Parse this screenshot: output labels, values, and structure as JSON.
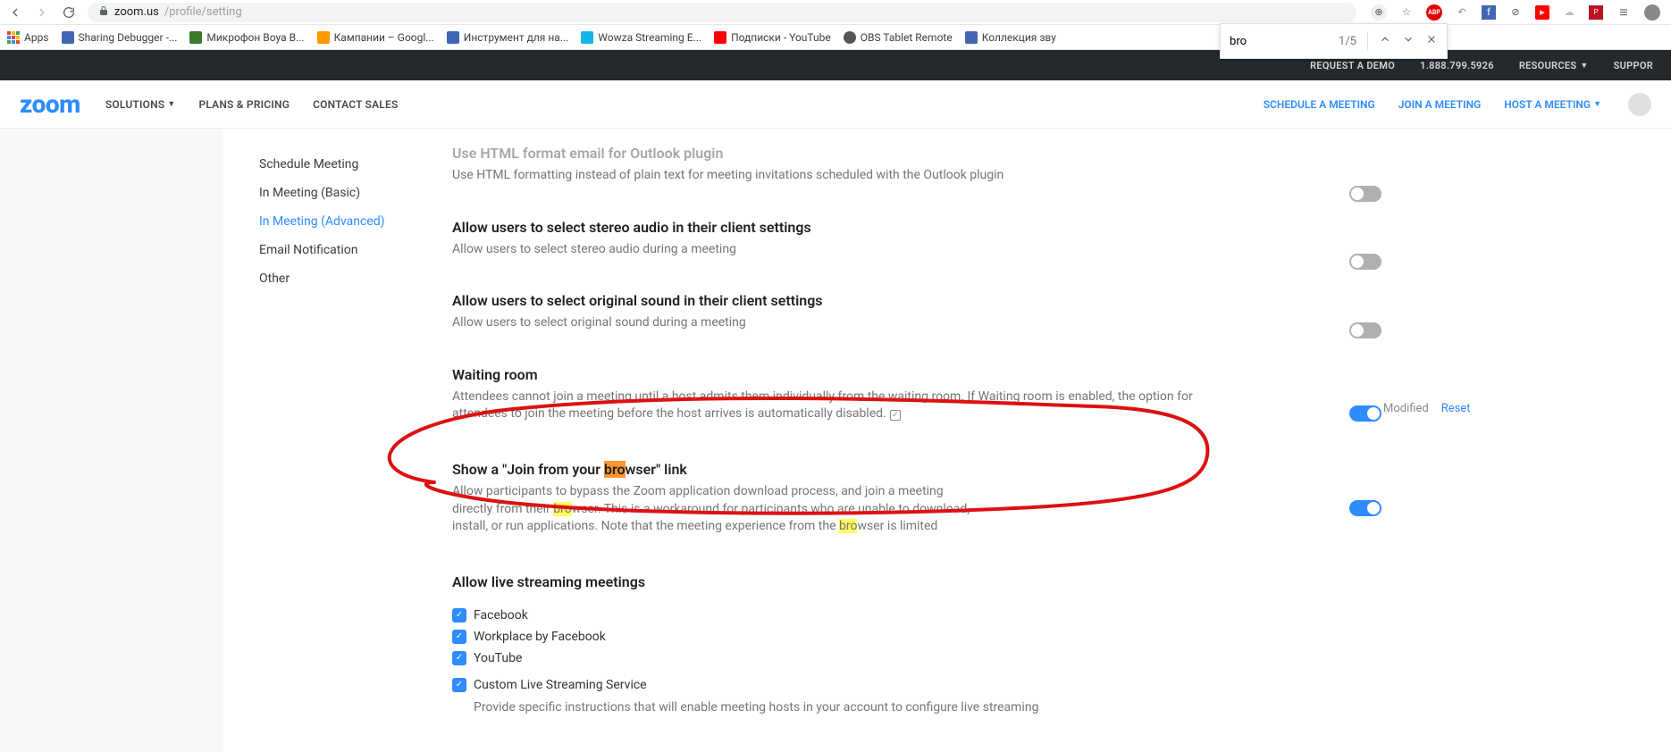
{
  "browser": {
    "url_host": "zoom.us",
    "url_path": "/profile/setting"
  },
  "find": {
    "query": "bro",
    "count": "1/5"
  },
  "bookmarks": [
    {
      "label": "Apps"
    },
    {
      "label": "Sharing Debugger -...",
      "bg": "#4267B2"
    },
    {
      "label": "Микрофон Boya B...",
      "bg": "#3a7a28"
    },
    {
      "label": "Кампании – Googl...",
      "bg": "#ff9800"
    },
    {
      "label": "Инструмент для на...",
      "bg": "#4267B2"
    },
    {
      "label": "Wowza Streaming E...",
      "bg": "#13b5ea"
    },
    {
      "label": "Подписки - YouTube",
      "bg": "#ff0000"
    },
    {
      "label": "OBS Tablet Remote",
      "bg": "#555"
    },
    {
      "label": "Коллекция зву",
      "bg": "#4267B2"
    }
  ],
  "topbar": {
    "demo": "REQUEST A DEMO",
    "phone": "1.888.799.5926",
    "resources": "RESOURCES",
    "support": "SUPPOR"
  },
  "nav": {
    "solutions": "SOLUTIONS",
    "pricing": "PLANS & PRICING",
    "contact": "CONTACT SALES",
    "schedule": "SCHEDULE A MEETING",
    "join": "JOIN A MEETING",
    "host": "HOST A MEETING"
  },
  "sidebar": [
    {
      "label": "Schedule Meeting",
      "active": false
    },
    {
      "label": "In Meeting (Basic)",
      "active": false
    },
    {
      "label": "In Meeting (Advanced)",
      "active": true
    },
    {
      "label": "Email Notification",
      "active": false
    },
    {
      "label": "Other",
      "active": false
    }
  ],
  "settings": {
    "s0": {
      "title": "Use HTML format email for Outlook plugin",
      "desc": "Use HTML formatting instead of plain text for meeting invitations scheduled with the Outlook plugin"
    },
    "s1": {
      "title": "Allow users to select stereo audio in their client settings",
      "desc": "Allow users to select stereo audio during a meeting"
    },
    "s2": {
      "title": "Allow users to select original sound in their client settings",
      "desc": "Allow users to select original sound during a meeting"
    },
    "s3": {
      "title": "Waiting room",
      "desc": "Attendees cannot join a meeting until a host admits them individually from the waiting room. If Waiting room is enabled, the option for attendees to join the meeting before the host arrives is automatically disabled."
    },
    "s4": {
      "title_a": "Show a \"Join from your ",
      "title_b": "bro",
      "title_c": "wser\" link",
      "desc_a": "Allow participants to bypass the Zoom application download process, and join a meeting directly from their ",
      "desc_b": "bro",
      "desc_c": "wser. This is a workaround for participants who are unable to download, install, or run applications. Note that the meeting experience from the ",
      "desc_d": "bro",
      "desc_e": "wser is limited"
    },
    "s5": {
      "title": "Allow live streaming meetings"
    },
    "modified": "Modified",
    "reset": "Reset",
    "stream_opts": [
      "Facebook",
      "Workplace by Facebook",
      "YouTube",
      "Custom Live Streaming Service"
    ],
    "custom_desc": "Provide specific instructions that will enable meeting hosts in your account to configure live streaming"
  }
}
